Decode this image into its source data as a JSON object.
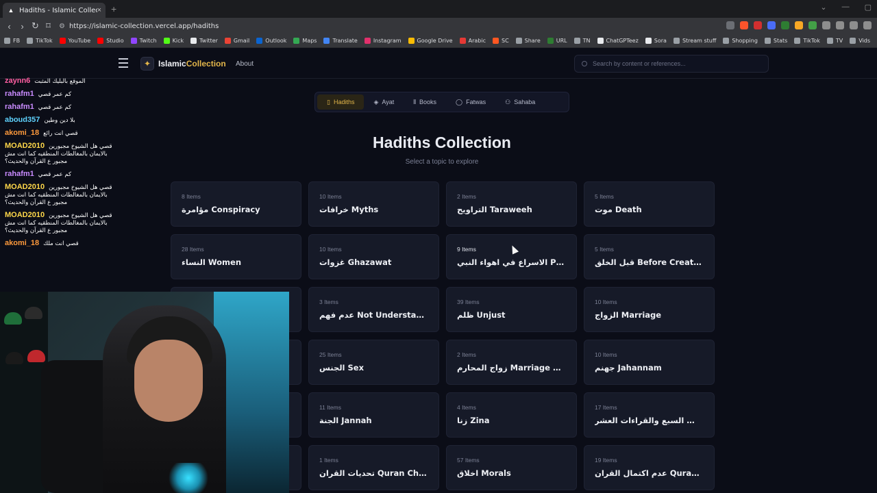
{
  "browser": {
    "tab_title": "Hadiths - Islamic Collection",
    "tab_close": "×",
    "new_tab": "+",
    "url": "https://islamic-collection.vercel.app/hadiths",
    "bookmarks": [
      {
        "label": "FB",
        "color": "#9aa0a6"
      },
      {
        "label": "TikTok",
        "color": "#9aa0a6"
      },
      {
        "label": "YouTube",
        "color": "#ff0000"
      },
      {
        "label": "Studio",
        "color": "#ff0000"
      },
      {
        "label": "Twitch",
        "color": "#9146ff"
      },
      {
        "label": "Kick",
        "color": "#53fc18"
      },
      {
        "label": "Twitter",
        "color": "#e8eaed"
      },
      {
        "label": "Gmail",
        "color": "#ea4335"
      },
      {
        "label": "Outlook",
        "color": "#0a64d0"
      },
      {
        "label": "Maps",
        "color": "#34a853"
      },
      {
        "label": "Translate",
        "color": "#4285f4"
      },
      {
        "label": "Instagram",
        "color": "#e1306c"
      },
      {
        "label": "Google Drive",
        "color": "#fbbc04"
      },
      {
        "label": "Arabic",
        "color": "#e53935"
      },
      {
        "label": "SC",
        "color": "#ff5722"
      },
      {
        "label": "Share",
        "color": "#9aa0a6"
      },
      {
        "label": "URL",
        "color": "#2e7d32"
      },
      {
        "label": "TN",
        "color": "#9aa0a6"
      },
      {
        "label": "ChatGPTeez",
        "color": "#e8eaed"
      },
      {
        "label": "Sora",
        "color": "#e8eaed"
      },
      {
        "label": "Stream stuff",
        "color": "#9aa0a6"
      },
      {
        "label": "Shopping",
        "color": "#9aa0a6"
      },
      {
        "label": "Stats",
        "color": "#9aa0a6"
      },
      {
        "label": "TikTok",
        "color": "#9aa0a6"
      },
      {
        "label": "TV",
        "color": "#9aa0a6"
      },
      {
        "label": "Vids",
        "color": "#9aa0a6"
      }
    ]
  },
  "site": {
    "brand": "IslamicCollection",
    "brand_prefix": "Islamic",
    "brand_suffix": "Collection",
    "about": "About",
    "search_placeholder": "Search by content or references...",
    "accent": "#e3b64a",
    "tabs": [
      {
        "label": "Hadiths",
        "icon": "book-icon",
        "glyph": "▯",
        "active": true
      },
      {
        "label": "Ayat",
        "icon": "layers-icon",
        "glyph": "◈",
        "active": false
      },
      {
        "label": "Books",
        "icon": "library-icon",
        "glyph": "⫴",
        "active": false
      },
      {
        "label": "Fatwas",
        "icon": "chat-icon",
        "glyph": "◯",
        "active": false
      },
      {
        "label": "Sahaba",
        "icon": "users-icon",
        "glyph": "⚇",
        "active": false
      }
    ],
    "heading": "Hadiths Collection",
    "subheading": "Select a topic to explore",
    "topics": [
      {
        "count": "8 Items",
        "name": "مؤامرة Conspiracy"
      },
      {
        "count": "10 Items",
        "name": "خرافات Myths"
      },
      {
        "count": "2 Items",
        "name": "التراويح Taraweeh"
      },
      {
        "count": "5 Items",
        "name": "موت Death"
      },
      {
        "count": "28 Items",
        "name": "النساء Women"
      },
      {
        "count": "10 Items",
        "name": "غزوات Ghazawat"
      },
      {
        "count": "9 Items",
        "name": "الاسراع في اهواء النبي Pleasing T..."
      },
      {
        "count": "5 Items",
        "name": "قبل الخلق Before Creation"
      },
      {
        "count": "",
        "name": ""
      },
      {
        "count": "3 Items",
        "name": "عدم فهم Not Understanding"
      },
      {
        "count": "39 Items",
        "name": "ظلم Unjust"
      },
      {
        "count": "10 Items",
        "name": "الزواج Marriage"
      },
      {
        "count": "",
        "name": ""
      },
      {
        "count": "25 Items",
        "name": "الجنس Sex"
      },
      {
        "count": "2 Items",
        "name": "زواج المحارم Marriage Of Family"
      },
      {
        "count": "10 Items",
        "name": "جهنم Jahannam"
      },
      {
        "count": "",
        "name": ""
      },
      {
        "count": "11 Items",
        "name": "الجنة Jannah"
      },
      {
        "count": "4 Items",
        "name": "زنا Zina"
      },
      {
        "count": "17 Items",
        "name": "الاحرف السبع والقراءات العشر Seve..."
      },
      {
        "count": "",
        "name": ""
      },
      {
        "count": "1 Items",
        "name": "تحديات القران Quran Challenges"
      },
      {
        "count": "57 Items",
        "name": "اخلاق Morals"
      },
      {
        "count": "19 Items",
        "name": "عدم اكتمال القران Quran Not Full"
      }
    ]
  },
  "chat": [
    {
      "user": "zaynn6",
      "color": "#ff5fa2",
      "msg": "الموقع بالبليك المثبت"
    },
    {
      "user": "rahafm1",
      "color": "#c98bff",
      "msg": "كم عمر قصي"
    },
    {
      "user": "rahafm1",
      "color": "#c98bff",
      "msg": "كم عمر قصي"
    },
    {
      "user": "aboud357",
      "color": "#5fd3ff",
      "msg": "بلا دين وطين"
    },
    {
      "user": "akomi_18",
      "color": "#ff9a3c",
      "msg": "قصي انت رائع"
    },
    {
      "user": "MOAD2010",
      "color": "#ffd84a",
      "msg": "قصي هل الشيوخ مجبورين بالايمان بالمغالطات المنطقيه كما انت مش مجبور ع القرآن والحديث؟"
    },
    {
      "user": "rahafm1",
      "color": "#c98bff",
      "msg": "كم عمر قصي"
    },
    {
      "user": "MOAD2010",
      "color": "#ffd84a",
      "msg": "قصي هل الشيوخ مجبورين بالايمان بالمغالطات المنطقيه كما انت مش مجبور ع القرآن والحديث؟"
    },
    {
      "user": "MOAD2010",
      "color": "#ffd84a",
      "msg": "قصي هل الشيوخ مجبورين بالايمان بالمغالطات المنطقيه كما انت مش مجبور ع القرآن والحديث؟"
    },
    {
      "user": "akomi_18",
      "color": "#ff9a3c",
      "msg": "قصي انت ملك"
    }
  ]
}
